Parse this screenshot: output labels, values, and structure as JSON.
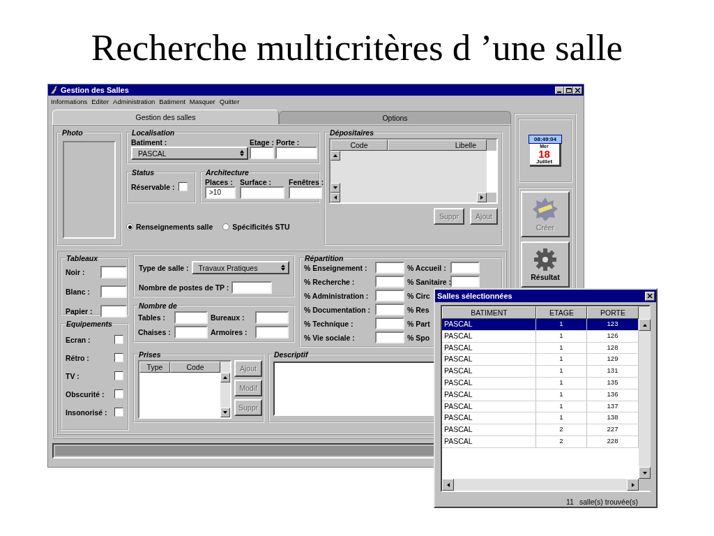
{
  "slide_title": "Recherche multicritères d ’une salle",
  "window": {
    "title": "Gestion des Salles"
  },
  "menu": [
    "Informations",
    "Editer",
    "Administration",
    "Batiment",
    "Masquer",
    "Quitter"
  ],
  "tabs": [
    {
      "label": "Gestion des salles",
      "selected": true
    },
    {
      "label": "Options",
      "selected": false
    }
  ],
  "photo": {
    "title": "Photo"
  },
  "localisation": {
    "title": "Localisation",
    "batiment": {
      "label": "Batiment :",
      "value": "PASCAL"
    },
    "etage_porte": {
      "label": "Etage : Porte :"
    }
  },
  "status": {
    "title": "Status",
    "reservable": {
      "label": "Réservable :",
      "checked": false
    }
  },
  "architecture": {
    "title": "Architecture",
    "fields": [
      {
        "label": "Places :",
        "value": ">10"
      },
      {
        "label": "Surface :"
      },
      {
        "label": "Fenêtres :"
      }
    ]
  },
  "view_options": [
    {
      "label": "Renseignements salle",
      "selected": true
    },
    {
      "label": "Spécificités STU",
      "selected": false
    }
  ],
  "depositaires": {
    "title": "Dépositaires",
    "columns": [
      "Code",
      "Libelle"
    ],
    "buttons": [
      {
        "label": "Suppr",
        "disabled": true
      },
      {
        "label": "Ajout",
        "disabled": true
      }
    ]
  },
  "tableaux": {
    "title": "Tableaux",
    "fields": [
      {
        "label": "Noir :"
      },
      {
        "label": "Blanc :"
      },
      {
        "label": "Papier :"
      }
    ]
  },
  "equipements": {
    "title": "Equipements",
    "items": [
      {
        "label": "Ecran :",
        "checked": false
      },
      {
        "label": "Rétro :",
        "checked": false
      },
      {
        "label": "TV :",
        "checked": false
      },
      {
        "label": "Obscurité :",
        "checked": false
      },
      {
        "label": "Insonorisé :",
        "checked": false
      }
    ]
  },
  "type_salle": {
    "label": "Type de salle :",
    "value": "Travaux Pratiques"
  },
  "postes_tp": {
    "label": "Nombre de postes de TP :"
  },
  "nombre_de": {
    "title": "Nombre de",
    "fields": [
      {
        "label": "Tables :"
      },
      {
        "label": "Bureaux :"
      },
      {
        "label": "Chaises :"
      },
      {
        "label": "Armoires :"
      }
    ]
  },
  "prises": {
    "title": "Prises",
    "columns": [
      "Type",
      "Code"
    ],
    "buttons": [
      {
        "label": "Ajout",
        "disabled": true
      },
      {
        "label": "Modif",
        "disabled": true
      },
      {
        "label": "Suppr",
        "disabled": true
      }
    ]
  },
  "repartition": {
    "title": "Répartition",
    "left": [
      {
        "label": "% Enseignement :"
      },
      {
        "label": "% Recherche :"
      },
      {
        "label": "% Administration :"
      },
      {
        "label": "% Documentation :"
      },
      {
        "label": "% Technique :"
      },
      {
        "label": "% Vie sociale :"
      }
    ],
    "right": [
      {
        "label": "% Accueil :",
        "kind": "field"
      },
      {
        "label": "% Sanitaire :",
        "kind": "field"
      },
      {
        "label": "% Circ",
        "kind": "label"
      },
      {
        "label": "% Res",
        "kind": "label"
      },
      {
        "label": "% Part",
        "kind": "label"
      },
      {
        "label": "% Spo",
        "kind": "label"
      }
    ]
  },
  "descriptif": {
    "title": "Descriptif"
  },
  "clock": {
    "time": "08:49:04",
    "weekday": "Mer",
    "day": "18",
    "month": "Juillet"
  },
  "side_buttons": [
    {
      "label": "Créer",
      "kind": "new",
      "disabled": true
    },
    {
      "label": "Résultat",
      "kind": "gear",
      "disabled": false
    }
  ],
  "dialog": {
    "title": "Salles sélectionnées",
    "columns": [
      "BATIMENT",
      "ETAGE",
      "PORTE"
    ],
    "rows": [
      {
        "cells": [
          "PASCAL",
          "1",
          "123"
        ],
        "selected": true
      },
      {
        "cells": [
          "PASCAL",
          "1",
          "126"
        ],
        "selected": false
      },
      {
        "cells": [
          "PASCAL",
          "1",
          "128"
        ],
        "selected": false
      },
      {
        "cells": [
          "PASCAL",
          "1",
          "129"
        ],
        "selected": false
      },
      {
        "cells": [
          "PASCAL",
          "1",
          "131"
        ],
        "selected": false
      },
      {
        "cells": [
          "PASCAL",
          "1",
          "135"
        ],
        "selected": false
      },
      {
        "cells": [
          "PASCAL",
          "1",
          "136"
        ],
        "selected": false
      },
      {
        "cells": [
          "PASCAL",
          "1",
          "137"
        ],
        "selected": false
      },
      {
        "cells": [
          "PASCAL",
          "1",
          "138"
        ],
        "selected": false
      },
      {
        "cells": [
          "PASCAL",
          "2",
          "227"
        ],
        "selected": false
      },
      {
        "cells": [
          "PASCAL",
          "2",
          "228"
        ],
        "selected": false
      }
    ],
    "count": "11",
    "count_label": "salle(s) trouvée(s)"
  }
}
